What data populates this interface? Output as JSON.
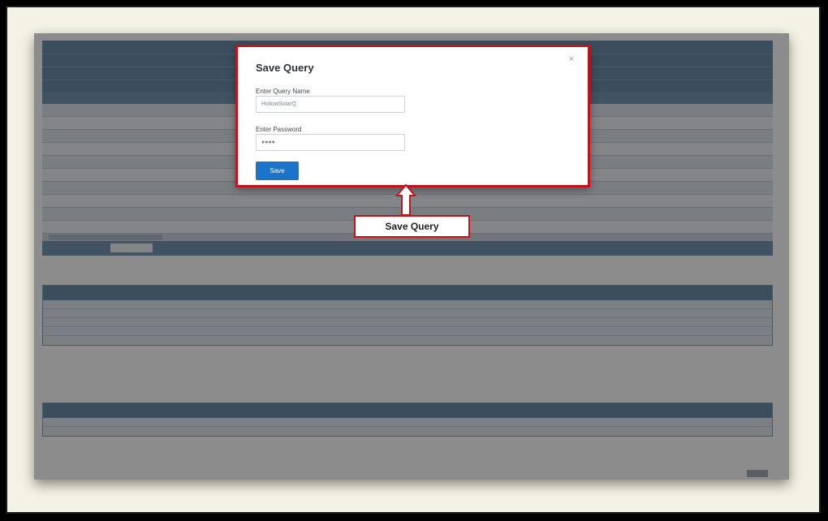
{
  "modal": {
    "title": "Save Query",
    "close_symbol": "×",
    "query_name_label": "Enter Query Name",
    "query_name_value": "HollowSolarQ",
    "password_label": "Enter Password",
    "password_value": "●●●●",
    "save_label": "Save"
  },
  "callout": {
    "text": "Save Query"
  }
}
